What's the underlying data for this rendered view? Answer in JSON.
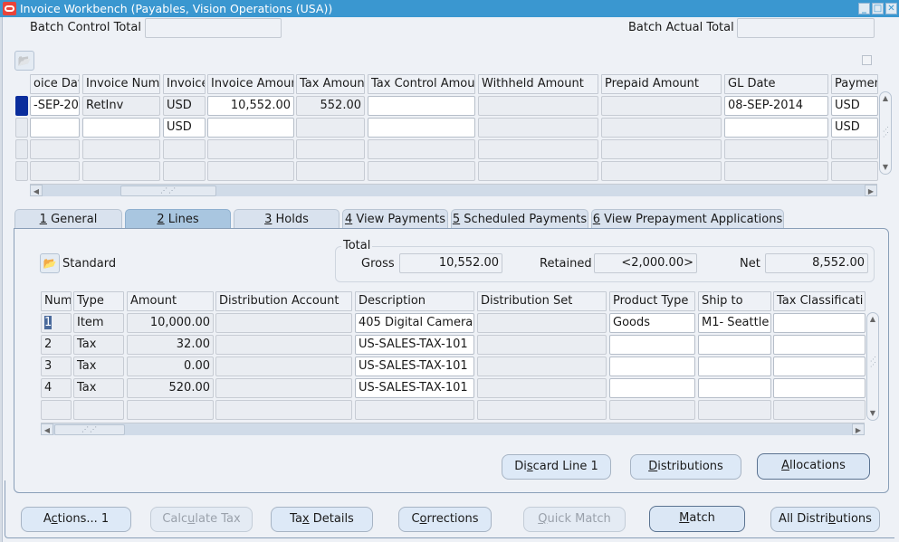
{
  "window": {
    "title": "Invoice Workbench (Payables, Vision Operations (USA))",
    "controls": {
      "minimize": "_",
      "maximize": "□",
      "close": "✕"
    }
  },
  "header": {
    "batch_control_total_label": "Batch Control Total",
    "batch_control_total_value": "",
    "batch_actual_total_label": "Batch Actual Total",
    "batch_actual_total_value": ""
  },
  "invoices": {
    "columns": [
      "oice Dat",
      "Invoice Num",
      "Invoice",
      "Invoice Amour",
      "Tax Amoun",
      "Tax Control Amou",
      "Withheld Amount",
      "Prepaid Amount",
      "GL Date",
      "Paymen"
    ],
    "rows": [
      {
        "invoice_date": "-SEP-20:",
        "invoice_num": "RetInv",
        "currency": "USD",
        "invoice_amount": "10,552.00",
        "tax_amount": "552.00",
        "tax_control_amount": "",
        "withheld_amount": "",
        "prepaid_amount": "",
        "gl_date": "08-SEP-2014",
        "payment_currency": "USD"
      },
      {
        "invoice_date": "",
        "invoice_num": "",
        "currency": "USD",
        "invoice_amount": "",
        "tax_amount": "",
        "tax_control_amount": "",
        "withheld_amount": "",
        "prepaid_amount": "",
        "gl_date": "",
        "payment_currency": "USD"
      },
      {
        "invoice_date": "",
        "invoice_num": "",
        "currency": "",
        "invoice_amount": "",
        "tax_amount": "",
        "tax_control_amount": "",
        "withheld_amount": "",
        "prepaid_amount": "",
        "gl_date": "",
        "payment_currency": ""
      },
      {
        "invoice_date": "",
        "invoice_num": "",
        "currency": "",
        "invoice_amount": "",
        "tax_amount": "",
        "tax_control_amount": "",
        "withheld_amount": "",
        "prepaid_amount": "",
        "gl_date": "",
        "payment_currency": ""
      }
    ]
  },
  "tabs": [
    {
      "key": "1",
      "label": " General"
    },
    {
      "key": "2",
      "label": " Lines",
      "active": true
    },
    {
      "key": "3",
      "label": " Holds"
    },
    {
      "key": "4",
      "label": " View Payments"
    },
    {
      "key": "5",
      "label": " Scheduled Payments"
    },
    {
      "key": "6",
      "label": " View Prepayment Applications"
    }
  ],
  "lines_tab": {
    "folder_label": "Standard",
    "total": {
      "legend": "Total",
      "gross_label": "Gross",
      "gross_value": "10,552.00",
      "retained_label": "Retained",
      "retained_value": "<2,000.00>",
      "net_label": "Net",
      "net_value": "8,552.00"
    },
    "columns": [
      "Num",
      "Type",
      "Amount",
      "Distribution Account",
      "Description",
      "Distribution Set",
      "Product Type",
      "Ship to",
      "Tax Classificati"
    ],
    "rows": [
      {
        "num": "1",
        "type": "Item",
        "amount": "10,000.00",
        "distribution_account": "",
        "description": "405 Digital Camera",
        "distribution_set": "",
        "product_type": "Goods",
        "ship_to": "M1- Seattle",
        "tax_classification": ""
      },
      {
        "num": "2",
        "type": "Tax",
        "amount": "32.00",
        "distribution_account": "",
        "description": "US-SALES-TAX-101",
        "distribution_set": "",
        "product_type": "",
        "ship_to": "",
        "tax_classification": ""
      },
      {
        "num": "3",
        "type": "Tax",
        "amount": "0.00",
        "distribution_account": "",
        "description": "US-SALES-TAX-101",
        "distribution_set": "",
        "product_type": "",
        "ship_to": "",
        "tax_classification": ""
      },
      {
        "num": "4",
        "type": "Tax",
        "amount": "520.00",
        "distribution_account": "",
        "description": "US-SALES-TAX-101",
        "distribution_set": "",
        "product_type": "",
        "ship_to": "",
        "tax_classification": ""
      },
      {
        "num": "",
        "type": "",
        "amount": "",
        "distribution_account": "",
        "description": "",
        "distribution_set": "",
        "product_type": "",
        "ship_to": "",
        "tax_classification": ""
      }
    ],
    "buttons": {
      "discard_line": {
        "pre": "Di",
        "u": "s",
        "post": "card Line 1"
      },
      "distributions": {
        "pre": "",
        "u": "D",
        "post": "istributions"
      },
      "allocations": {
        "pre": "",
        "u": "A",
        "post": "llocations"
      }
    }
  },
  "footer_buttons": {
    "actions": {
      "pre": "A",
      "u": "c",
      "post": "tions... 1"
    },
    "calculate_tax": {
      "pre": "Calc",
      "u": "u",
      "post": "late Tax"
    },
    "tax_details": {
      "pre": "Ta",
      "u": "x",
      "post": " Details"
    },
    "corrections": {
      "pre": "C",
      "u": "o",
      "post": "rrections"
    },
    "quick_match": {
      "pre": "",
      "u": "Q",
      "post": "uick Match"
    },
    "match": {
      "pre": "",
      "u": "M",
      "post": "atch"
    },
    "all_distributions": {
      "pre": "All Distri",
      "u": "b",
      "post": "utions"
    }
  },
  "icons": {
    "folder_open": "📂",
    "scroll_left": "◀",
    "scroll_right": "▶",
    "scroll_up": "▲",
    "scroll_down": "▼",
    "grip": "⋰⋰"
  }
}
